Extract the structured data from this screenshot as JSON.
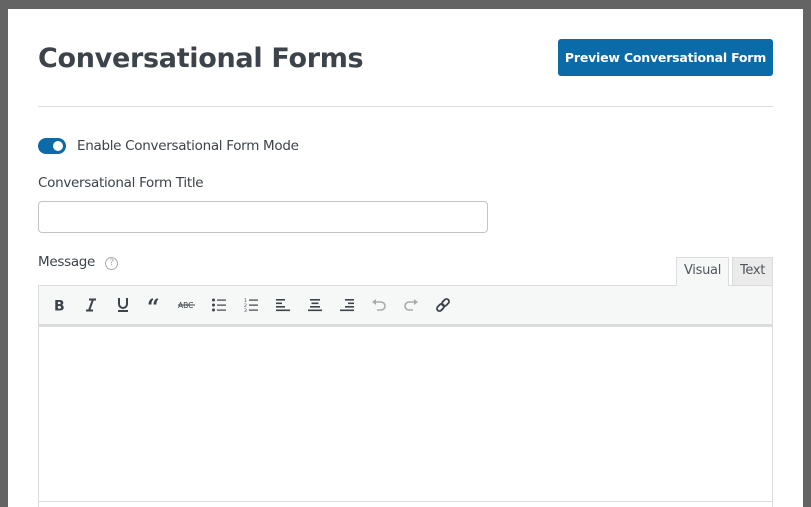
{
  "header": {
    "title": "Conversational Forms",
    "preview_button_label": "Preview Conversational Form"
  },
  "toggle": {
    "label": "Enable Conversational Form Mode",
    "enabled": true
  },
  "title_field": {
    "label": "Conversational Form Title",
    "value": "",
    "placeholder": ""
  },
  "message_field": {
    "label": "Message",
    "help_icon": "question-circle-icon",
    "value": ""
  },
  "editor": {
    "tabs": [
      {
        "label": "Visual",
        "active": true
      },
      {
        "label": "Text",
        "active": false
      }
    ],
    "toolbar": [
      {
        "name": "bold",
        "icon": "bold-icon"
      },
      {
        "name": "italic",
        "icon": "italic-icon"
      },
      {
        "name": "underline",
        "icon": "underline-icon"
      },
      {
        "name": "blockquote",
        "icon": "quote-icon"
      },
      {
        "name": "strikethrough",
        "icon": "strikethrough-icon",
        "glyph": "ABC"
      },
      {
        "name": "bulleted-list",
        "icon": "bullet-list-icon"
      },
      {
        "name": "numbered-list",
        "icon": "numbered-list-icon"
      },
      {
        "name": "align-left",
        "icon": "align-left-icon"
      },
      {
        "name": "align-center",
        "icon": "align-center-icon"
      },
      {
        "name": "align-right",
        "icon": "align-right-icon"
      },
      {
        "name": "undo",
        "icon": "undo-icon",
        "disabled": true
      },
      {
        "name": "redo",
        "icon": "redo-icon",
        "disabled": true
      },
      {
        "name": "link",
        "icon": "link-icon"
      }
    ]
  },
  "colors": {
    "accent": "#0b6aa8",
    "text": "#3c434a",
    "border": "#dcdcde",
    "frame": "#646464"
  }
}
